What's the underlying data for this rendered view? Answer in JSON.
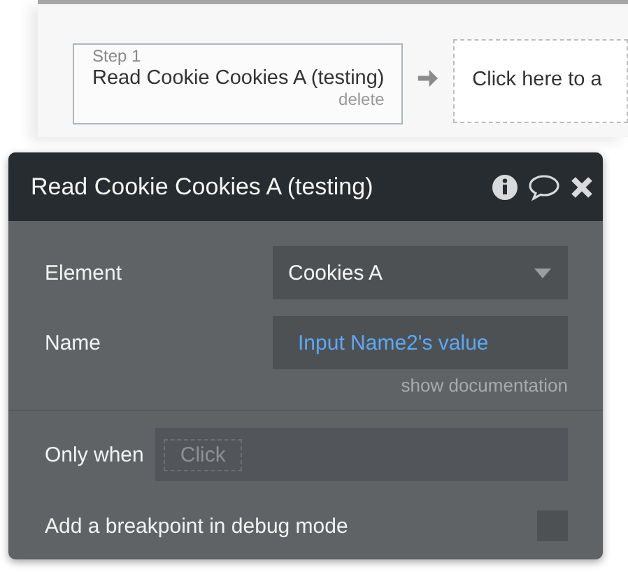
{
  "workflow": {
    "steps": [
      {
        "label": "Step 1",
        "title": "Read Cookie Cookies A (testing)",
        "delete": "delete"
      }
    ],
    "add_step": "Click here to a"
  },
  "dialog": {
    "title": "Read Cookie Cookies A (testing)",
    "fields": [
      {
        "kind": "dropdown",
        "label": "Element",
        "value": "Cookies A"
      },
      {
        "kind": "dynamic",
        "label": "Name",
        "value": "Input Name2's value"
      }
    ],
    "documentation_link": "show documentation",
    "only_when": {
      "label": "Only when",
      "placeholder": "Click"
    },
    "breakpoint": {
      "label": "Add a breakpoint in debug mode",
      "checked": false
    }
  }
}
